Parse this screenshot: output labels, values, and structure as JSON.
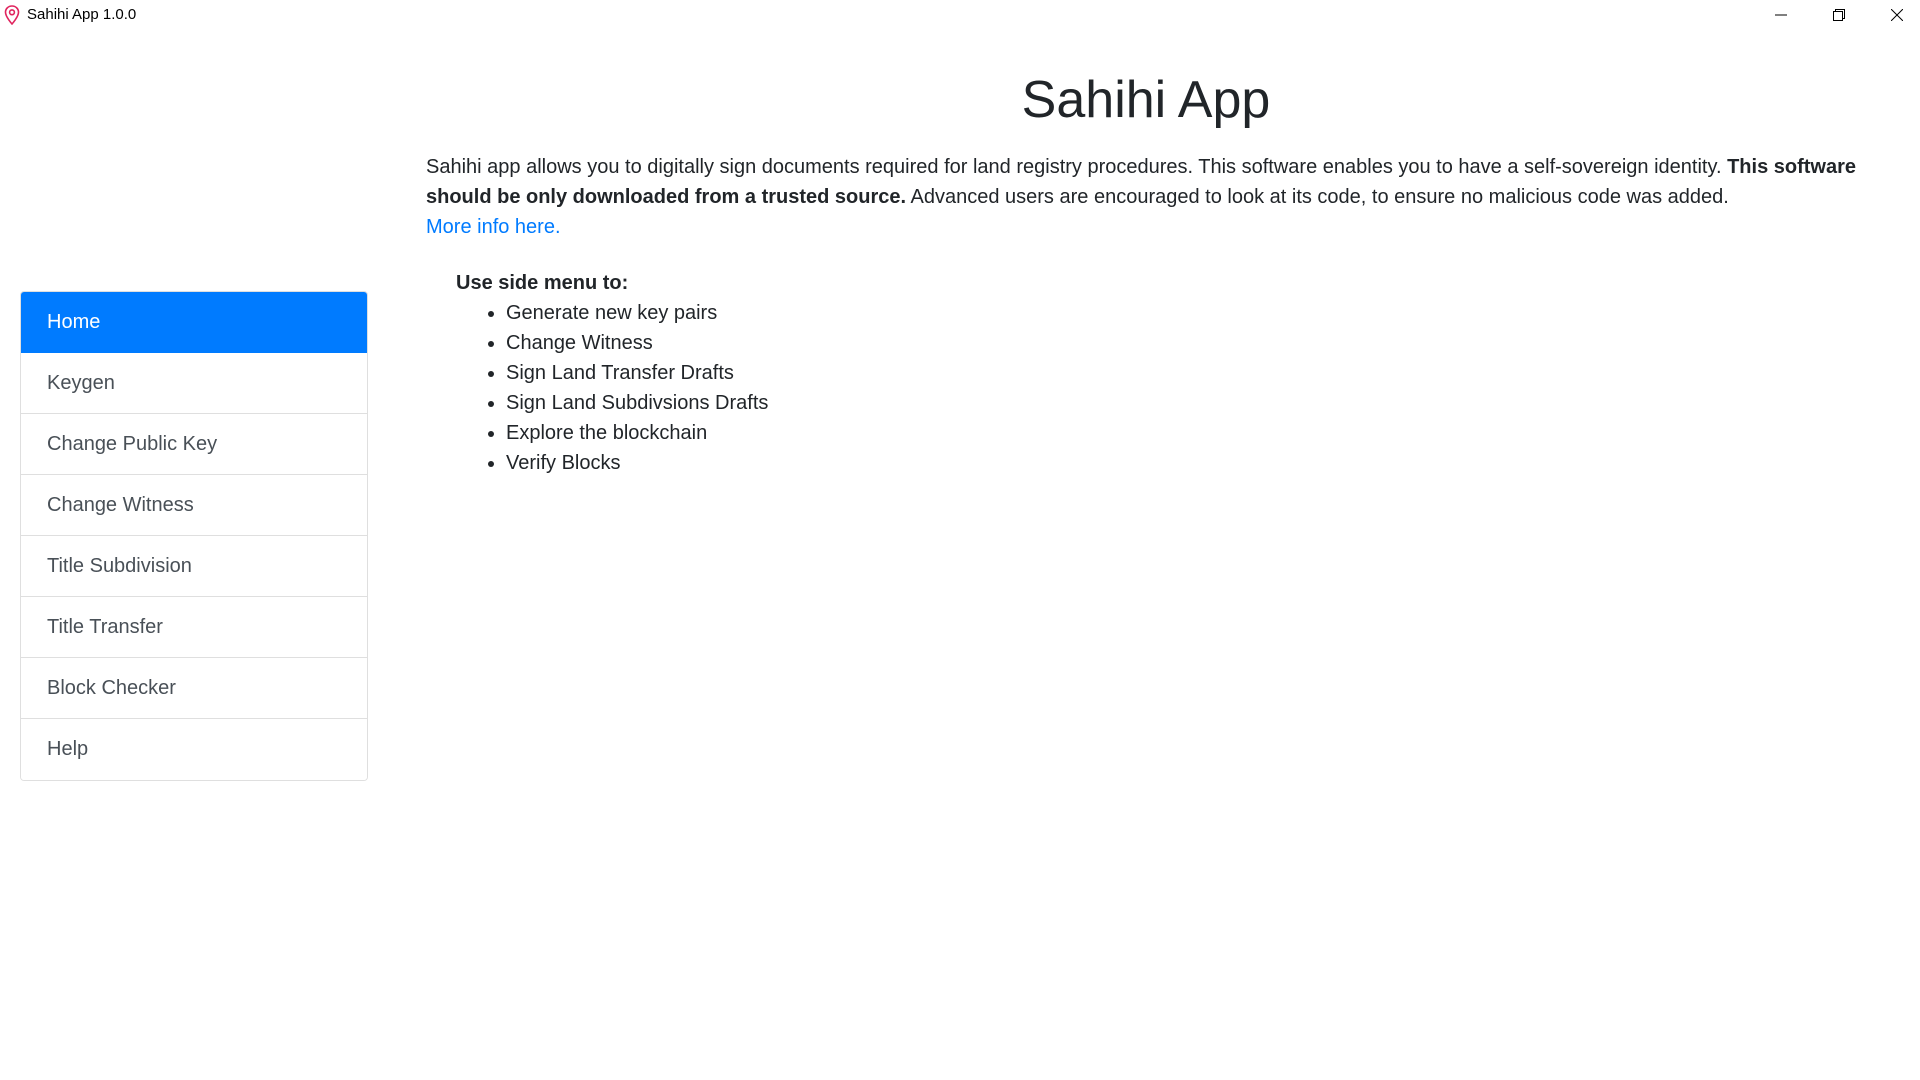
{
  "window": {
    "title": "Sahihi App 1.0.0",
    "icon": "map-pin-icon"
  },
  "sidebar": {
    "items": [
      {
        "label": "Home",
        "active": true
      },
      {
        "label": "Keygen"
      },
      {
        "label": "Change Public Key"
      },
      {
        "label": "Change Witness"
      },
      {
        "label": "Title Subdivision"
      },
      {
        "label": "Title Transfer"
      },
      {
        "label": "Block Checker"
      },
      {
        "label": "Help"
      }
    ]
  },
  "main": {
    "title": "Sahihi App",
    "intro_part1": "Sahihi app allows you to digitally sign documents required for land registry procedures. This software enables you to have a self-sovereign identity. ",
    "intro_bold": "This software should be only downloaded from a trusted source.",
    "intro_part2": " Advanced users are encouraged to look at its code, to ensure no malicious code was added.",
    "more_info_link": "More info here.",
    "menu_heading": "Use side menu to:",
    "menu_items": [
      "Generate new key pairs",
      "Change Witness",
      "Sign Land Transfer Drafts",
      "Sign Land Subdivsions Drafts",
      "Explore the blockchain",
      "Verify Blocks"
    ]
  },
  "colors": {
    "accent": "#007bff",
    "app_icon": "#e0245e"
  }
}
